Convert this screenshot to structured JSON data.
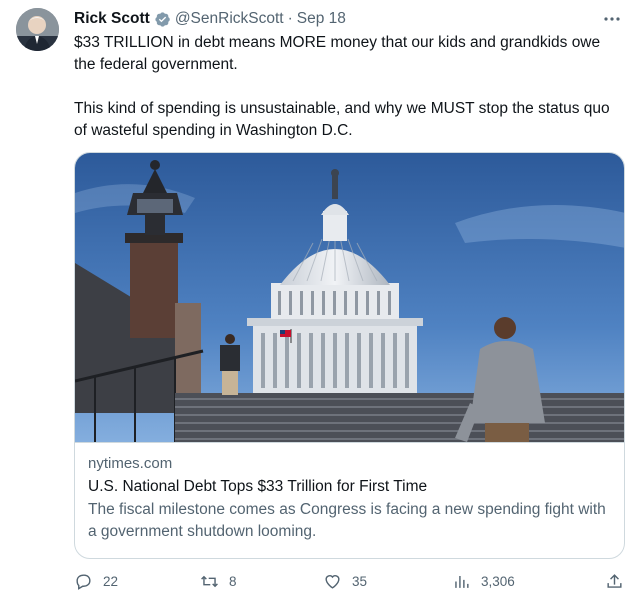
{
  "author": {
    "name": "Rick Scott",
    "handle": "@SenRickScott",
    "separator": "·",
    "date": "Sep 18",
    "more_icon": "more-horizontal-icon",
    "verified_color": "#1d9bf0"
  },
  "tweet": {
    "paragraph1": "$33 TRILLION in debt means MORE money that our kids and grandkids owe the federal government.",
    "paragraph2": "This kind of spending is unsustainable, and why we MUST stop the status quo of wasteful spending in Washington D.C."
  },
  "card": {
    "domain": "nytimes.com",
    "title": "U.S. National Debt Tops $33 Trillion for First Time",
    "description": "The fiscal milestone comes as Congress is facing a new spending fight with a government shutdown looming."
  },
  "actions": {
    "replies": "22",
    "retweets": "8",
    "likes": "35",
    "views": "3,306"
  },
  "colors": {
    "text": "#0f1419",
    "secondary": "#536471",
    "border": "#cfd9de"
  }
}
